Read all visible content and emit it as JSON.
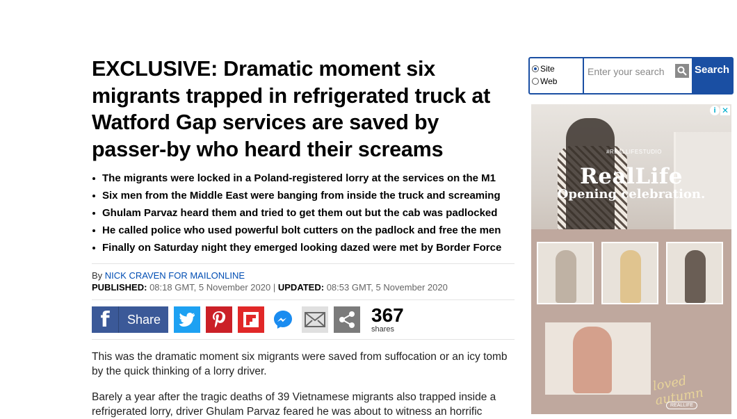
{
  "article": {
    "headline": "EXCLUSIVE: Dramatic moment six migrants trapped in refrigerated truck at Watford Gap services are saved by passer-by who heard their screams",
    "bullets": [
      "The migrants were locked in a Poland-registered lorry at the services on the M1",
      "Six men from the Middle East were banging from inside the truck and screaming",
      "Ghulam Parvaz heard them and tried to get them out but the cab was padlocked",
      "He called police who used powerful bolt cutters on the padlock and free the men",
      "Finally on Saturday night they emerged looking dazed were met by Border Force"
    ],
    "byline_prefix": "By",
    "author": "NICK CRAVEN FOR MAILONLINE",
    "published_label": "PUBLISHED:",
    "published": "08:18 GMT, 5 November 2020",
    "separator": "|",
    "updated_label": "UPDATED:",
    "updated": "08:53 GMT, 5 November 2020",
    "paragraphs": [
      "This was the dramatic moment six migrants were saved from suffocation or an icy tomb by the quick thinking of a lorry driver.",
      "Barely a year after the tragic deaths of 39 Vietnamese migrants also trapped inside a refrigerated lorry, driver Ghulam Parvaz feared he was about to witness an horrific"
    ]
  },
  "share": {
    "facebook_label": "Share",
    "count": "367",
    "count_label": "shares",
    "icons": [
      "facebook-icon",
      "twitter-icon",
      "pinterest-icon",
      "flipboard-icon",
      "messenger-icon",
      "email-icon",
      "share-icon"
    ],
    "colors": {
      "facebook": "#3b5998",
      "twitter": "#1da1f2",
      "pinterest": "#cb2027",
      "flipboard": "#e12828"
    }
  },
  "search": {
    "option_site": "Site",
    "option_web": "Web",
    "selected": "Site",
    "placeholder": "Enter your search",
    "button": "Search",
    "accent": "#1a4fa3"
  },
  "ad": {
    "tag": "#REALLIFESTUDIO",
    "brand": "RealLife",
    "subtitle": "Opening celebration.",
    "script_text": "loved autumn",
    "small_logo": "REALLIFE"
  }
}
